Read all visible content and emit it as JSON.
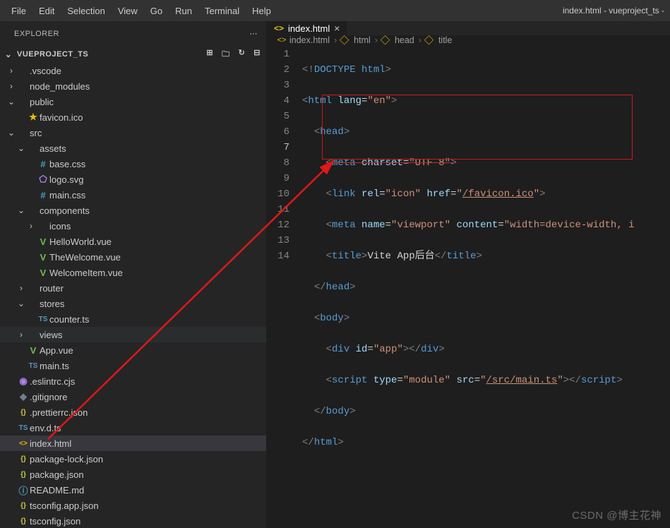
{
  "menubar": [
    "File",
    "Edit",
    "Selection",
    "View",
    "Go",
    "Run",
    "Terminal",
    "Help"
  ],
  "windowTitle": "index.html - vueproject_ts -",
  "explorer": {
    "title": "EXPLORER",
    "project": "VUEPROJECT_TS"
  },
  "tree": [
    {
      "depth": 0,
      "chev": "›",
      "icon": "",
      "ic": "",
      "label": ".vscode"
    },
    {
      "depth": 0,
      "chev": "›",
      "icon": "",
      "ic": "",
      "label": "node_modules"
    },
    {
      "depth": 0,
      "chev": "⌄",
      "icon": "",
      "ic": "",
      "label": "public"
    },
    {
      "depth": 1,
      "chev": "",
      "icon": "★",
      "ic": "ic-yellow",
      "label": "favicon.ico"
    },
    {
      "depth": 0,
      "chev": "⌄",
      "icon": "",
      "ic": "",
      "label": "src"
    },
    {
      "depth": 1,
      "chev": "⌄",
      "icon": "",
      "ic": "",
      "label": "assets"
    },
    {
      "depth": 2,
      "chev": "",
      "icon": "#",
      "ic": "ic-blue",
      "label": "base.css"
    },
    {
      "depth": 2,
      "chev": "",
      "icon": "⬠",
      "ic": "ic-purple",
      "label": "logo.svg"
    },
    {
      "depth": 2,
      "chev": "",
      "icon": "#",
      "ic": "ic-blue",
      "label": "main.css"
    },
    {
      "depth": 1,
      "chev": "⌄",
      "icon": "",
      "ic": "",
      "label": "components"
    },
    {
      "depth": 2,
      "chev": "›",
      "icon": "",
      "ic": "",
      "label": "icons"
    },
    {
      "depth": 2,
      "chev": "",
      "icon": "V",
      "ic": "ic-green",
      "label": "HelloWorld.vue"
    },
    {
      "depth": 2,
      "chev": "",
      "icon": "V",
      "ic": "ic-green",
      "label": "TheWelcome.vue"
    },
    {
      "depth": 2,
      "chev": "",
      "icon": "V",
      "ic": "ic-green",
      "label": "WelcomeItem.vue"
    },
    {
      "depth": 1,
      "chev": "›",
      "icon": "",
      "ic": "",
      "label": "router"
    },
    {
      "depth": 1,
      "chev": "⌄",
      "icon": "",
      "ic": "",
      "label": "stores"
    },
    {
      "depth": 2,
      "chev": "",
      "icon": "TS",
      "ic": "ic-blue",
      "label": "counter.ts"
    },
    {
      "depth": 1,
      "chev": "›",
      "icon": "",
      "ic": "",
      "label": "views",
      "cls": "views"
    },
    {
      "depth": 1,
      "chev": "",
      "icon": "V",
      "ic": "ic-green",
      "label": "App.vue"
    },
    {
      "depth": 1,
      "chev": "",
      "icon": "TS",
      "ic": "ic-blue",
      "label": "main.ts"
    },
    {
      "depth": 0,
      "chev": "",
      "icon": "◉",
      "ic": "ic-purple",
      "label": ".eslintrc.cjs"
    },
    {
      "depth": 0,
      "chev": "",
      "icon": "◆",
      "ic": "ic-gray",
      "label": ".gitignore"
    },
    {
      "depth": 0,
      "chev": "",
      "icon": "{}",
      "ic": "ic-jsonbr",
      "label": ".prettierrc.json"
    },
    {
      "depth": 0,
      "chev": "",
      "icon": "TS",
      "ic": "ic-blue",
      "label": "env.d.ts"
    },
    {
      "depth": 0,
      "chev": "",
      "icon": "<>",
      "ic": "ic-yellow",
      "label": "index.html",
      "cls": "selected"
    },
    {
      "depth": 0,
      "chev": "",
      "icon": "{}",
      "ic": "ic-jsonbr",
      "label": "package-lock.json"
    },
    {
      "depth": 0,
      "chev": "",
      "icon": "{}",
      "ic": "ic-jsonbr",
      "label": "package.json"
    },
    {
      "depth": 0,
      "chev": "",
      "icon": "ⓘ",
      "ic": "ic-info",
      "label": "README.md"
    },
    {
      "depth": 0,
      "chev": "",
      "icon": "{}",
      "ic": "ic-jsonbr",
      "label": "tsconfig.app.json"
    },
    {
      "depth": 0,
      "chev": "",
      "icon": "{}",
      "ic": "ic-jsonbr",
      "label": "tsconfig.json"
    }
  ],
  "tab": {
    "icon": "<>",
    "label": "index.html"
  },
  "breadcrumb": [
    {
      "icon": "<>",
      "ic": "ic-yellow",
      "label": "index.html"
    },
    {
      "icon": "⃟",
      "ic": "ic-yellow",
      "label": "html"
    },
    {
      "icon": "⃟",
      "ic": "ic-yellow",
      "label": "head"
    },
    {
      "icon": "⃟",
      "ic": "ic-yellow",
      "label": "title"
    }
  ],
  "code": {
    "lines": 14,
    "current": 7,
    "l1": {
      "a": "<!",
      "b": "DOCTYPE",
      "c": " html",
      "d": ">"
    },
    "l2": {
      "a": "<",
      "b": "html",
      "c": " lang",
      "d": "=",
      "e": "\"en\"",
      "f": ">"
    },
    "l3": {
      "a": "<",
      "b": "head",
      "c": ">"
    },
    "l4": {
      "a": "<",
      "b": "meta",
      "c": " charset",
      "d": "=",
      "e": "\"UTF-8\"",
      "f": ">"
    },
    "l5": {
      "a": "<",
      "b": "link",
      "c": " rel",
      "d": "=",
      "e": "\"icon\"",
      "f": " href",
      "g": "=",
      "h": "\"",
      "i": "/favicon.ico",
      "j": "\"",
      "k": ">"
    },
    "l6": {
      "a": "<",
      "b": "meta",
      "c": " name",
      "d": "=",
      "e": "\"viewport\"",
      "f": " content",
      "g": "=",
      "h": "\"width=device-width, i"
    },
    "l7": {
      "a": "<",
      "b": "title",
      "c": ">",
      "d": "Vite App后台",
      "e": "</",
      "f": "title",
      "g": ">"
    },
    "l8": {
      "a": "</",
      "b": "head",
      "c": ">"
    },
    "l9": {
      "a": "<",
      "b": "body",
      "c": ">"
    },
    "l10": {
      "a": "<",
      "b": "div",
      "c": " id",
      "d": "=",
      "e": "\"app\"",
      "f": "></",
      "g": "div",
      "h": ">"
    },
    "l11": {
      "a": "<",
      "b": "script",
      "c": " type",
      "d": "=",
      "e": "\"module\"",
      "f": " src",
      "g": "=",
      "h": "\"",
      "i": "/src/main.ts",
      "j": "\"",
      "k": "></",
      "l": "script",
      "m": ">"
    },
    "l12": {
      "a": "</",
      "b": "body",
      "c": ">"
    },
    "l13": {
      "a": "</",
      "b": "html",
      "c": ">"
    }
  },
  "watermark": "CSDN @博主花神"
}
